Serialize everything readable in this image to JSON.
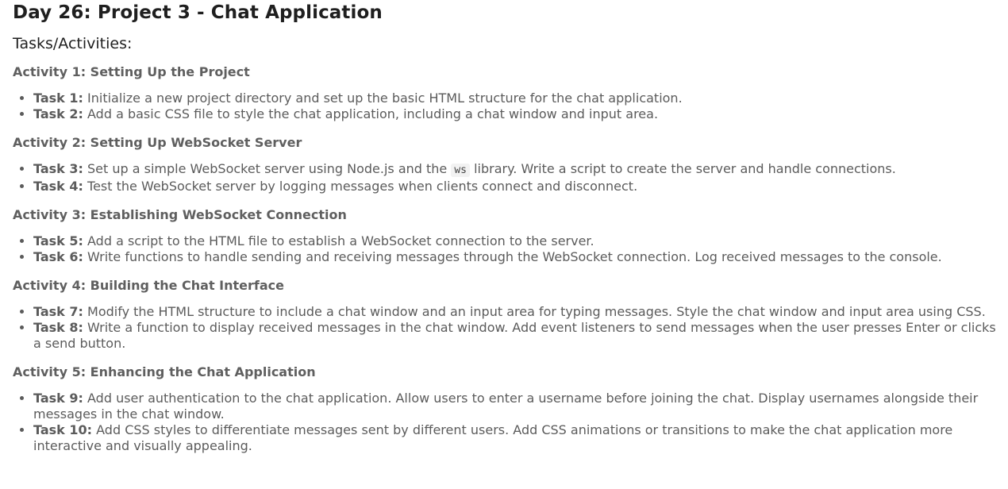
{
  "title": "Day 26: Project 3 - Chat Application",
  "subtitle": "Tasks/Activities:",
  "activities": [
    {
      "title": "Activity 1: Setting Up the Project",
      "tasks": [
        {
          "label": "Task 1:",
          "text": "Initialize a new project directory and set up the basic HTML structure for the chat application."
        },
        {
          "label": "Task 2:",
          "text": "Add a basic CSS file to style the chat application, including a chat window and input area."
        }
      ]
    },
    {
      "title": "Activity 2: Setting Up WebSocket Server",
      "tasks": [
        {
          "label": "Task 3:",
          "text_before": "Set up a simple WebSocket server using Node.js and the",
          "code": "ws",
          "text_after": "library. Write a script to create the server and handle connections."
        },
        {
          "label": "Task 4:",
          "text": "Test the WebSocket server by logging messages when clients connect and disconnect."
        }
      ]
    },
    {
      "title": "Activity 3: Establishing WebSocket Connection",
      "tasks": [
        {
          "label": "Task 5:",
          "text": "Add a script to the HTML file to establish a WebSocket connection to the server."
        },
        {
          "label": "Task 6:",
          "text": "Write functions to handle sending and receiving messages through the WebSocket connection. Log received messages to the console."
        }
      ]
    },
    {
      "title": "Activity 4: Building the Chat Interface",
      "tasks": [
        {
          "label": "Task 7:",
          "text": "Modify the HTML structure to include a chat window and an input area for typing messages. Style the chat window and input area using CSS."
        },
        {
          "label": "Task 8:",
          "text": "Write a function to display received messages in the chat window. Add event listeners to send messages when the user presses Enter or clicks a send button."
        }
      ]
    },
    {
      "title": "Activity 5: Enhancing the Chat Application",
      "tasks": [
        {
          "label": "Task 9:",
          "text": "Add user authentication to the chat application. Allow users to enter a username before joining the chat. Display usernames alongside their messages in the chat window."
        },
        {
          "label": "Task 10:",
          "text": "Add CSS styles to differentiate messages sent by different users. Add CSS animations or transitions to make the chat application more interactive and visually appealing."
        }
      ]
    }
  ]
}
